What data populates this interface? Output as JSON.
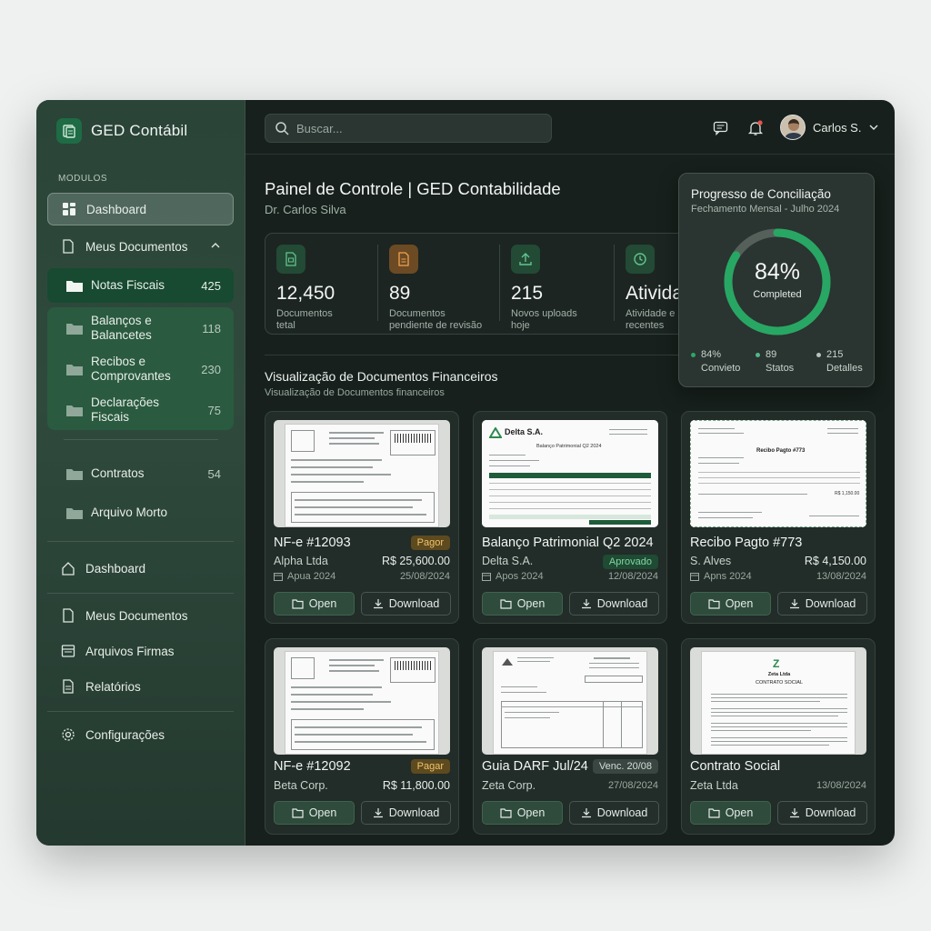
{
  "app": {
    "name": "GED Contábil"
  },
  "sidebar": {
    "section_label": "MODULOS",
    "dashboard": "Dashboard",
    "meus_documentos": "Meus Documentos",
    "folders": [
      {
        "label": "Notas Fiscais",
        "count": "425"
      },
      {
        "label": "Balanços e Balancetes",
        "count": "118"
      },
      {
        "label": "Recibos e Comprovantes",
        "count": "230"
      },
      {
        "label": "Declarações Fiscais",
        "count": "75"
      },
      {
        "label": "Contratos",
        "count": "54"
      },
      {
        "label": "Arquivo Morto",
        "count": ""
      }
    ],
    "bottom": [
      {
        "label": "Dashboard",
        "icon": "home-icon"
      },
      {
        "label": "Meus Documentos",
        "icon": "document-icon"
      },
      {
        "label": "Arquivos Firmas",
        "icon": "archive-icon"
      },
      {
        "label": "Relatórios",
        "icon": "report-icon"
      },
      {
        "label": "Configurações",
        "icon": "gear-icon"
      }
    ]
  },
  "topbar": {
    "search_placeholder": "Buscar...",
    "user_name": "Carlos S."
  },
  "page": {
    "title": "Painel de Controle | GED Contabilidade",
    "subtitle": "Dr. Carlos Silva"
  },
  "stats": [
    {
      "value": "12,450",
      "label1": "Documentos",
      "label2": "tetal"
    },
    {
      "value": "89",
      "label1": "Documentos",
      "label2": "pendiente de revisão"
    },
    {
      "value": "215",
      "label1": "Novos uploads",
      "label2": "hoje"
    },
    {
      "value": "Atividades",
      "label1": "Atividade e",
      "label2": "recentes"
    }
  ],
  "progress": {
    "title": "Progresso de Conciliação",
    "subtitle": "Fechamento Mensal - Julho 2024",
    "percent_text": "84%",
    "percent": 0.84,
    "center_label": "Completed",
    "legend": [
      {
        "value": "84%",
        "label": "Convieto",
        "color": "#2aa866"
      },
      {
        "value": "89",
        "label": "Statos",
        "color": "#4fb88a"
      },
      {
        "value": "215",
        "label": "Detalles",
        "color": "#b9c2be"
      }
    ]
  },
  "section": {
    "title": "Visualização de Documentos Financeiros",
    "subtitle": "Visualização de Documentos financeiros"
  },
  "buttons": {
    "open": "Open",
    "download": "Download"
  },
  "cards": [
    {
      "title": "NF-e #12093",
      "badge": "Pagor",
      "name": "Alpha Ltda",
      "amount": "R$ 25,600.00",
      "meta": "Apua 2024",
      "date": "25/08/2024"
    },
    {
      "title": "Balanço Patrimonial Q2 2024",
      "badge": "Aprovado",
      "name": "Delta S.A.",
      "amount": "",
      "meta": "Apos 2024",
      "date": "12/08/2024",
      "doc_brand": "Delta S.A.",
      "doc_heading": "Balanço Patrimonial Q2 2024"
    },
    {
      "title": "Recibo Pagto #773",
      "badge": "",
      "name": "S. Alves",
      "amount": "R$ 4,150.00",
      "meta": "Apns 2024",
      "date": "13/08/2024",
      "doc_heading": "Recibo Pagto #773",
      "doc_amount": "R$ 1,150.00"
    },
    {
      "title": "NF-e #12092",
      "badge": "Pagar",
      "name": "Beta Corp.",
      "amount": "R$ 11,800.00",
      "meta": "",
      "date": ""
    },
    {
      "title": "Guia DARF Jul/24",
      "badge": "Venc. 20/08",
      "name": "Zeta Corp.",
      "amount": "",
      "meta": "",
      "date": "27/08/2024"
    },
    {
      "title": "Contrato Social",
      "badge": "",
      "name": "Zeta Ltda",
      "amount": "",
      "meta": "",
      "date": "13/08/2024",
      "doc_brand": "Zeta Ltda",
      "doc_heading": "CONTRATO SOCIAL"
    }
  ]
}
